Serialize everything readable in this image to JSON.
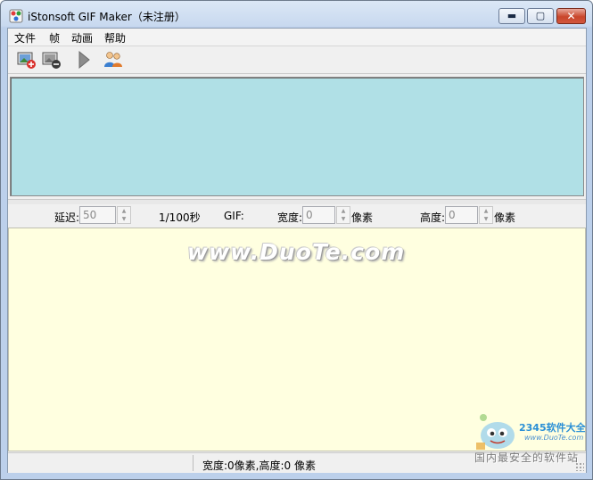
{
  "window": {
    "title": "iStonsoft GIF Maker（未注册）"
  },
  "title_buttons": {
    "minimize": "▬",
    "maximize": "▢",
    "close": "✕"
  },
  "menu": {
    "items": [
      {
        "label": "文件"
      },
      {
        "label": "帧"
      },
      {
        "label": "动画"
      },
      {
        "label": "帮助"
      }
    ]
  },
  "toolbar": {
    "buttons": [
      {
        "icon": "add-image-icon"
      },
      {
        "icon": "remove-image-icon"
      },
      {
        "icon": "play-icon"
      },
      {
        "icon": "users-icon"
      }
    ]
  },
  "params": {
    "delay_label": "延迟:",
    "delay_value": "50",
    "delay_unit": "1/100秒",
    "gif_label": "GIF:",
    "width_label": "宽度:",
    "width_value": "0",
    "width_unit": "像素",
    "height_label": "高度:",
    "height_value": "0",
    "height_unit": "像素"
  },
  "watermark": "www.DuoTe.com",
  "status": {
    "text": "宽度:0像素,高度:0 像素"
  },
  "corner_watermark": {
    "brand": "2345软件大全",
    "url": "www.DuoTe.com",
    "slogan": "国内最安全的软件站"
  },
  "colors": {
    "preview_bg": "#b0e0e6",
    "frames_bg": "#ffffe0",
    "close_button": "#c9462b"
  }
}
